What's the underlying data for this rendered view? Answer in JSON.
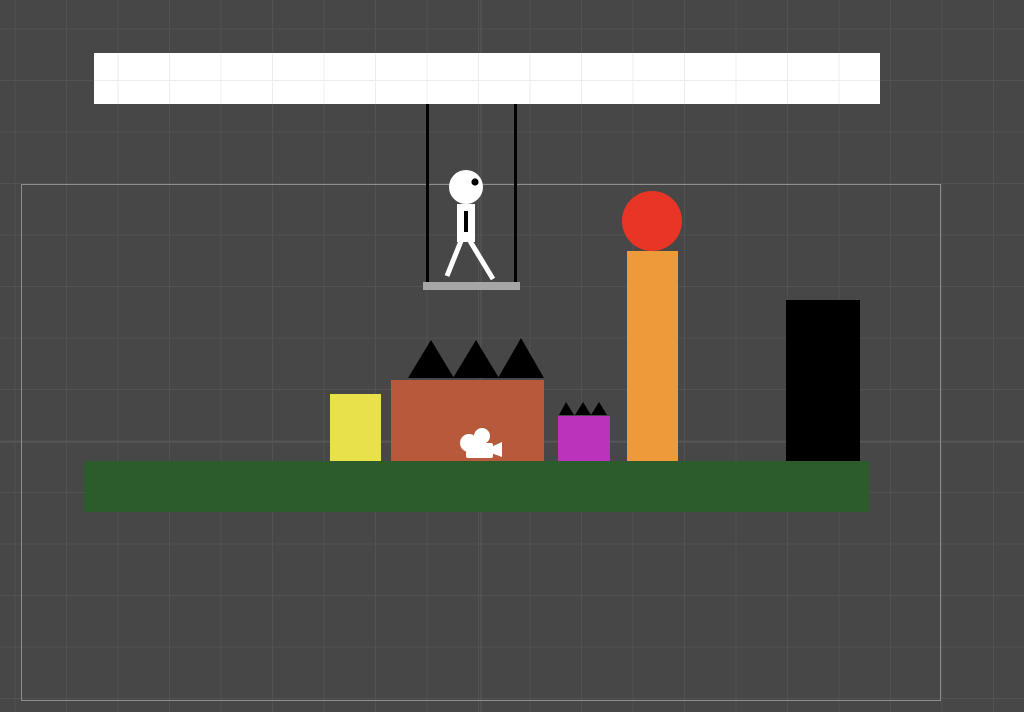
{
  "scene": {
    "background": "#474747",
    "grid_visible": true,
    "grid_color": "#525252",
    "grid_major_color": "#5a5a5a",
    "camera_bounds_color": "#8e8e8e"
  },
  "ceiling": {
    "color": "#ffffff",
    "grid_color": "#ececec"
  },
  "swing": {
    "rope_color": "#000000",
    "seat_color": "#a6a6a6"
  },
  "character": {
    "body_color": "#ffffff",
    "detail_color": "#000000",
    "pose": "walking"
  },
  "ground": {
    "color": "#2c5b2c"
  },
  "objects": {
    "yellow_block": {
      "color": "#e8e14a"
    },
    "brown_block": {
      "color": "#b65a3b"
    },
    "spikes": {
      "color": "#000000",
      "count": 3
    },
    "camera_gizmo": {
      "icon": "camera-icon",
      "color": "#ffffff"
    },
    "purple_block": {
      "color": "#bb33bb"
    },
    "small_spikes": {
      "color": "#000000",
      "count": 3
    },
    "orange_pillar": {
      "color": "#ef9a3a"
    },
    "red_ball": {
      "color": "#e93526"
    },
    "black_door": {
      "color": "#000000"
    }
  }
}
